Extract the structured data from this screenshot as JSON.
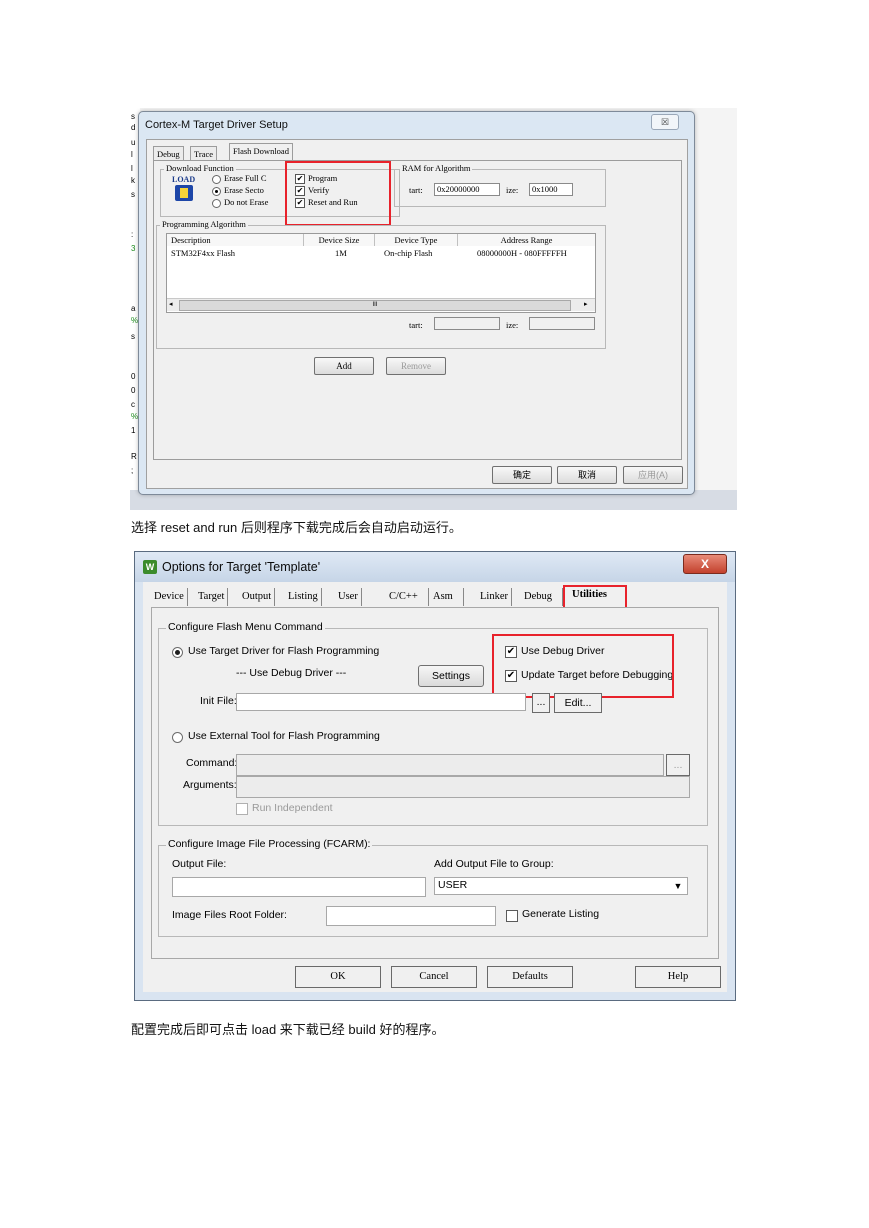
{
  "shot1": {
    "window_title": "Cortex-M Target Driver Setup",
    "close_glyph": "☒",
    "tabs": [
      "Debug",
      "Trace",
      "Flash Download"
    ],
    "download_function": {
      "group_label": "Download Function",
      "load_icon_text": "LOAD",
      "radios": [
        "Erase Full C",
        "Erase Secto",
        "Do not Erase"
      ],
      "checks": [
        "Program",
        "Verify",
        "Reset and Run"
      ]
    },
    "ram": {
      "group_label": "RAM for Algorithm",
      "start_label": "tart:",
      "start_value": "0x20000000",
      "size_label": "ize:",
      "size_value": "0x1000"
    },
    "programming": {
      "group_label": "Programming Algorithm",
      "columns": [
        "Description",
        "Device Size",
        "Device Type",
        "Address Range"
      ],
      "rows": [
        {
          "description": "STM32F4xx Flash",
          "size": "1M",
          "type": "On-chip Flash",
          "range": "08000000H - 080FFFFFH"
        }
      ],
      "scroll_mark": "III",
      "start_label": "tart:",
      "size_label": "ize:"
    },
    "add_button": "Add",
    "remove_button": "Remove",
    "ok_button": "确定",
    "cancel_button": "取消",
    "apply_button": "应用(A)",
    "left_strip_chars": [
      "s",
      "d",
      "u",
      "l",
      "l",
      "k",
      "s",
      "",
      "",
      ":",
      "3",
      "",
      "",
      "",
      "a",
      "%",
      "s",
      "",
      "",
      "0",
      "0",
      "c",
      "%",
      "1",
      "",
      "",
      "R",
      ";"
    ]
  },
  "caption1": "选择 reset and run 后则程序下载完成后会自动启动运行。",
  "shot2": {
    "window_title": "Options for Target 'Template'",
    "icon_glyph": "W",
    "close_glyph": "X",
    "tabs": [
      "Device",
      "Target",
      "Output",
      "Listing",
      "User",
      "C/C++",
      "Asm",
      "Linker",
      "Debug",
      "Utilities"
    ],
    "flash_group_label": "Configure Flash Menu Command",
    "use_target_driver": "Use Target Driver for Flash Programming",
    "use_debug_driver_note": "--- Use Debug Driver ---",
    "settings_button": "Settings",
    "use_debug_driver": "Use Debug Driver",
    "update_target": "Update Target before Debugging",
    "init_file_label": "Init File:",
    "browse_button": "...",
    "edit_button": "Edit...",
    "use_external_tool": "Use External Tool for Flash Programming",
    "command_label": "Command:",
    "arguments_label": "Arguments:",
    "run_independent": "Run Independent",
    "image_group_label": "Configure Image File Processing (FCARM):",
    "output_file_label": "Output File:",
    "add_output_label": "Add Output File  to Group:",
    "group_value": "USER",
    "dropdown_arrow": "▼",
    "root_folder_label": "Image Files Root Folder:",
    "generate_listing": "Generate Listing",
    "ok_button": "OK",
    "cancel_button": "Cancel",
    "defaults_button": "Defaults",
    "help_button": "Help"
  },
  "caption2": "配置完成后即可点击 load 来下载已经 build 好的程序。",
  "colors": {
    "highlight": "#e8222b",
    "title_bar": "#dbe7f3",
    "close_red": "#c3412d"
  }
}
